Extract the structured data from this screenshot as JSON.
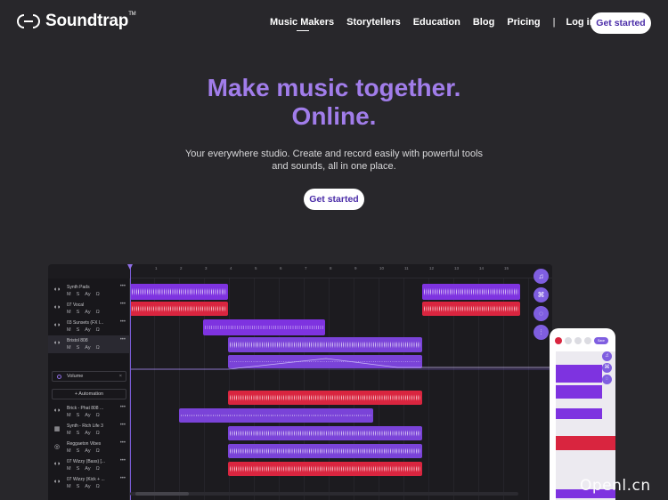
{
  "header": {
    "logo_text": "Soundtrap",
    "logo_mark": "TM",
    "nav": [
      "Music Makers",
      "Storytellers",
      "Education",
      "Blog",
      "Pricing"
    ],
    "separator": "|",
    "login": "Log in",
    "cta": "Get started"
  },
  "hero": {
    "title_line1": "Make music together.",
    "title_line2": "Online.",
    "subtitle_line1": "Your everywhere studio. Create and record easily with powerful tools",
    "subtitle_line2": "and sounds, all in one place.",
    "cta": "Get started"
  },
  "studio": {
    "ruler": [
      "1",
      "2",
      "3",
      "4",
      "5",
      "6",
      "7",
      "8",
      "9",
      "10",
      "11",
      "12",
      "13",
      "14",
      "15"
    ],
    "tracks": [
      {
        "name": "Synth Pads",
        "icon": "waveform-icon"
      },
      {
        "name": "07 Vocal",
        "icon": "waveform-icon"
      },
      {
        "name": "03 Sunsets (FX l...",
        "icon": "waveform-icon"
      },
      {
        "name": "Bristol 808",
        "icon": "waveform-icon"
      },
      {
        "name": "Brick - Phat 808 ...",
        "icon": "waveform-icon"
      },
      {
        "name": "Synth - Rich Life 3",
        "icon": "keyboard-icon"
      },
      {
        "name": "Reggaeton Vibes",
        "icon": "drum-icon"
      },
      {
        "name": "07 Wizzy (Bass) [...",
        "icon": "waveform-icon"
      },
      {
        "name": "07 Wizzy (Kick + ...",
        "icon": "waveform-icon"
      }
    ],
    "track_controls": [
      "M",
      "S",
      "Ay",
      "Ω"
    ],
    "track_menu": "•••",
    "automation": {
      "label": "Volume",
      "close": "×",
      "add_label": "+ Automation"
    },
    "side_tools": [
      "music-note-icon",
      "loops-icon",
      "chat-icon",
      "mixer-icon"
    ],
    "side_glyphs": [
      "♫",
      "⌘",
      "◌",
      "⫶"
    ]
  },
  "phone": {
    "play_label": "Save",
    "side_glyphs": [
      "♫",
      "⌘",
      "◌"
    ]
  },
  "watermark": "Openl.cn",
  "colors": {
    "background": "#28272b",
    "accent": "#a17dea",
    "clip_purple": "#7e33e0",
    "clip_red": "#d9253f"
  }
}
